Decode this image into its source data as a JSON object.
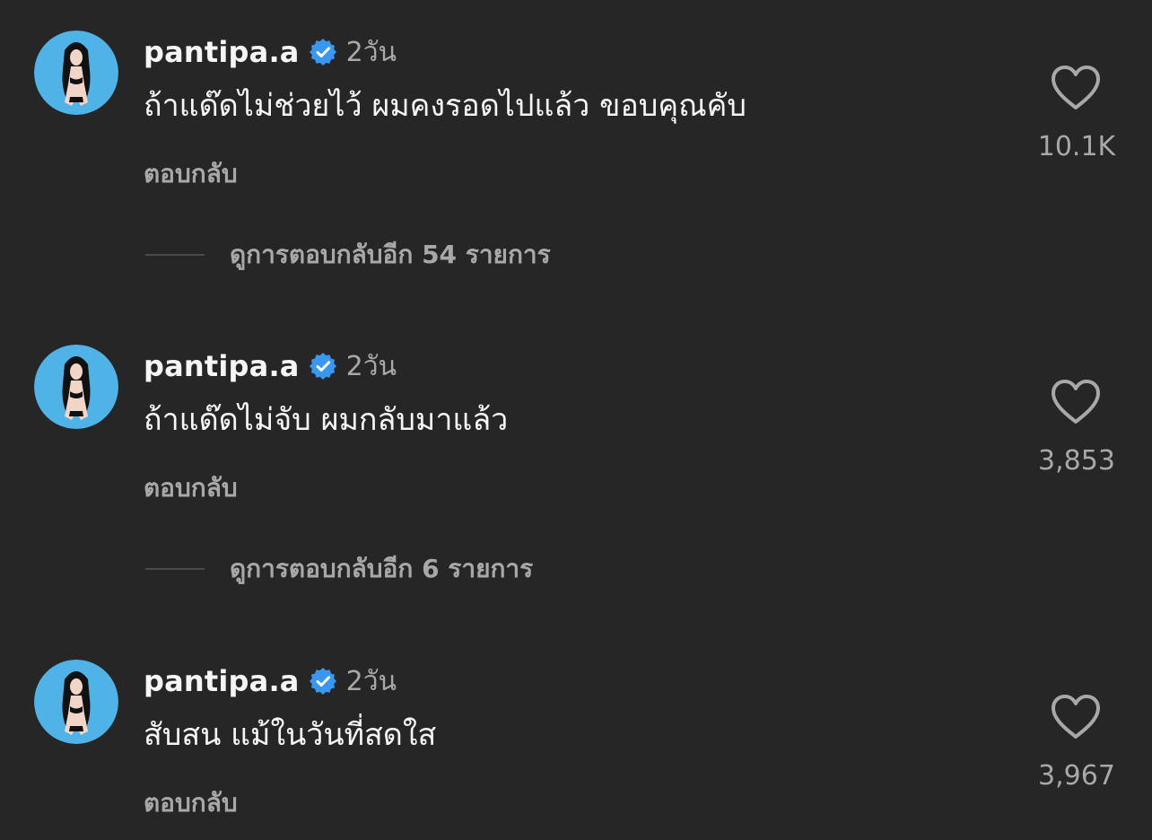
{
  "comments": [
    {
      "username": "pantipa.a",
      "time": "2วัน",
      "text": "ถ้าแด๊ดไม่ช่วยไว้ ผมคงรอดไปแล้ว ขอบคุณคับ",
      "reply_label": "ตอบกลับ",
      "likes": "10.1K",
      "view_replies": "ดูการตอบกลับอีก 54 รายการ"
    },
    {
      "username": "pantipa.a",
      "time": "2วัน",
      "text": "ถ้าแด๊ดไม่จับ ผมกลับมาแล้ว",
      "reply_label": "ตอบกลับ",
      "likes": "3,853",
      "view_replies": "ดูการตอบกลับอีก 6 รายการ"
    },
    {
      "username": "pantipa.a",
      "time": "2วัน",
      "text": "สับสน แม้ในวันที่สดใส",
      "reply_label": "ตอบกลับ",
      "likes": "3,967"
    }
  ],
  "colors": {
    "background": "#262626",
    "primary_text": "#f5f5f5",
    "secondary_text": "#a8a8a8",
    "verified_badge": "#3897f0",
    "avatar_bg": "#4fb3e8"
  },
  "icons": {
    "verified": "verified-badge-icon",
    "like": "heart-outline-icon",
    "avatar": "user-avatar"
  }
}
